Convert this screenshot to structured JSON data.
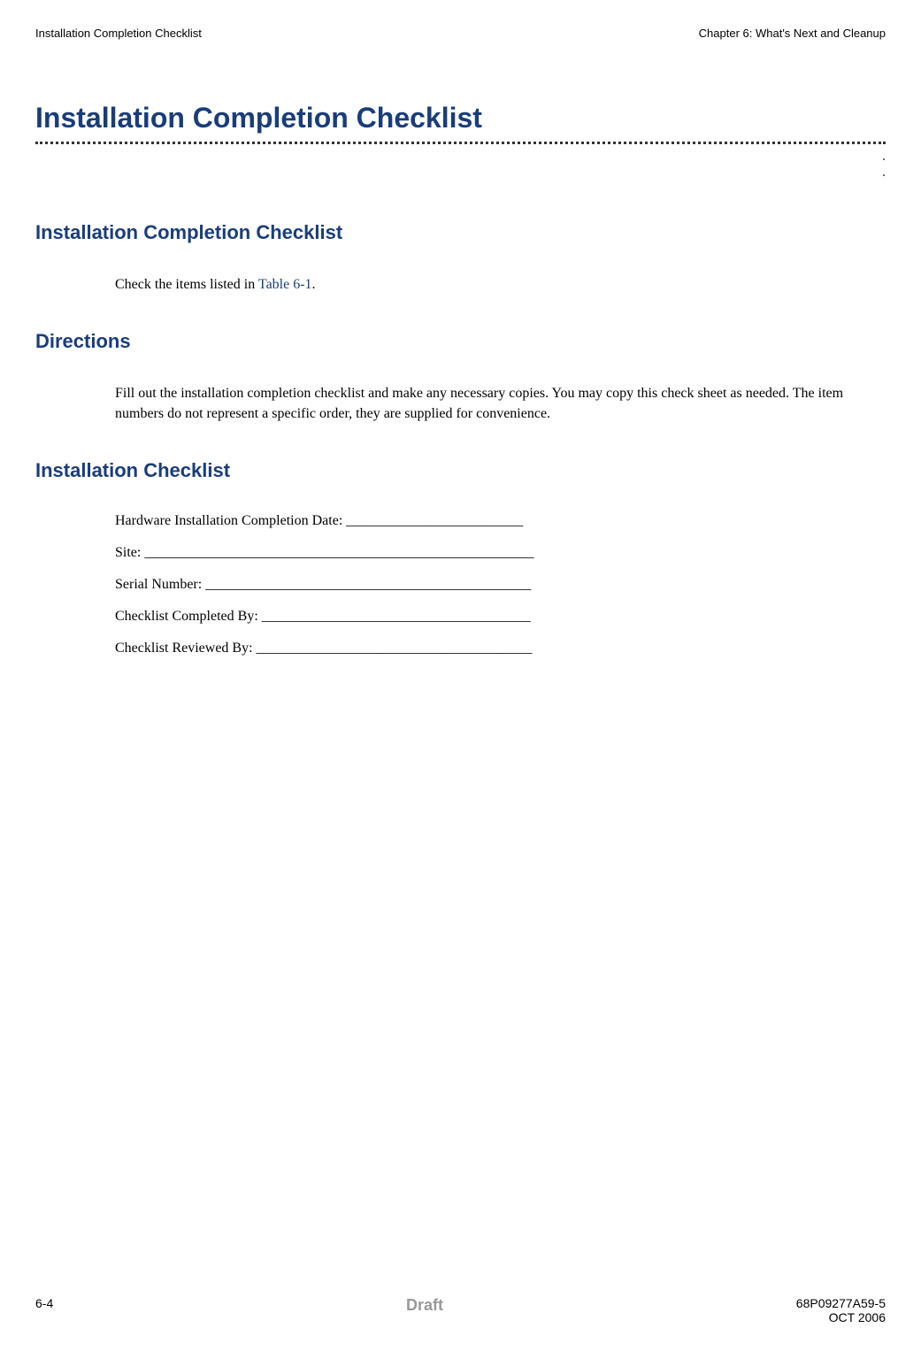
{
  "header": {
    "left": "Installation Completion Checklist",
    "right": "Chapter 6: What's Next and Cleanup"
  },
  "mainTitle": "Installation Completion Checklist",
  "sections": {
    "sub1": {
      "heading": "Installation Completion Checklist",
      "textPrefix": "Check the items listed in ",
      "linkText": "Table 6-1",
      "textSuffix": "."
    },
    "directions": {
      "heading": "Directions",
      "text": "Fill out the installation completion checklist and make any necessary copies. You may copy this check sheet as needed. The item numbers do not represent a specific order, they are supplied for convenience."
    },
    "checklist": {
      "heading": "Installation Checklist",
      "fields": {
        "hardwareDate": "Hardware Installation Completion Date: _________________________",
        "site": "Site: _______________________________________________________",
        "serialNumber": "Serial Number: ______________________________________________",
        "completedBy": "Checklist Completed By: ______________________________________",
        "reviewedBy": "Checklist Reviewed By: _______________________________________"
      }
    }
  },
  "footer": {
    "pageNumber": "6-4",
    "draft": "Draft",
    "docNumber": "68P09277A59-5",
    "date": "OCT 2006"
  }
}
